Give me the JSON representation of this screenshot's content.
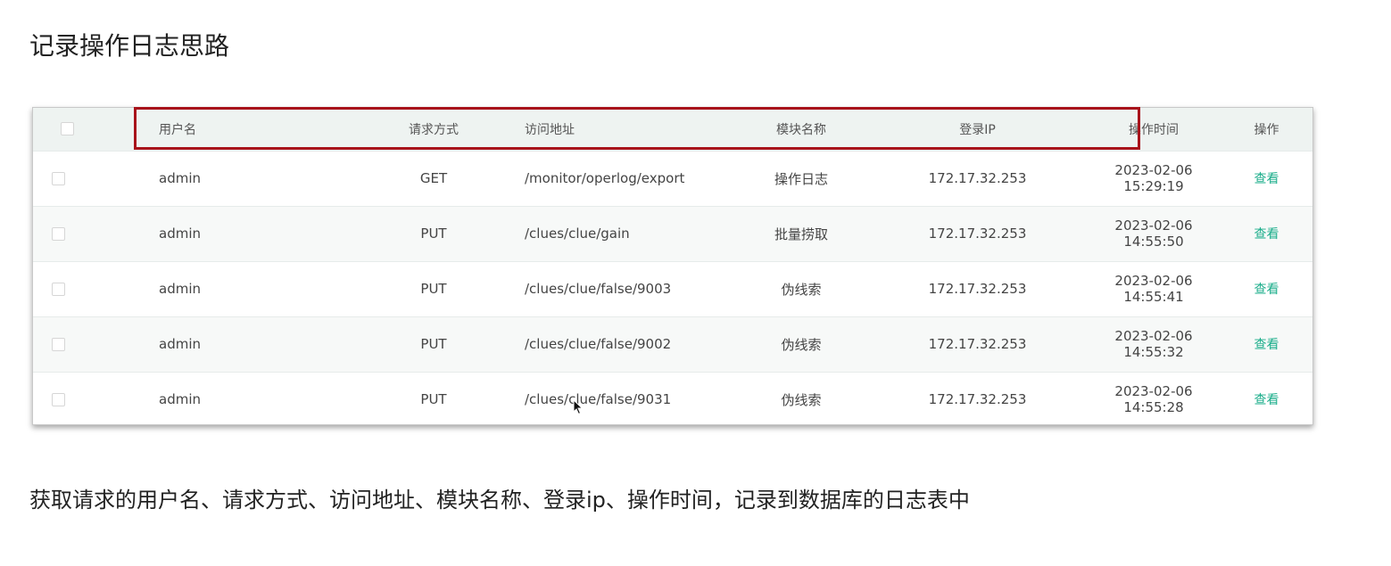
{
  "title": "记录操作日志思路",
  "table": {
    "headers": {
      "username": "用户名",
      "method": "请求方式",
      "url": "访问地址",
      "module": "模块名称",
      "ip": "登录IP",
      "time": "操作时间",
      "action": "操作"
    },
    "rows": [
      {
        "username": "admin",
        "method": "GET",
        "url": "/monitor/operlog/export",
        "module": "操作日志",
        "ip": "172.17.32.253",
        "time": "2023-02-06 15:29:19",
        "action": "查看"
      },
      {
        "username": "admin",
        "method": "PUT",
        "url": "/clues/clue/gain",
        "module": "批量捞取",
        "ip": "172.17.32.253",
        "time": "2023-02-06 14:55:50",
        "action": "查看"
      },
      {
        "username": "admin",
        "method": "PUT",
        "url": "/clues/clue/false/9003",
        "module": "伪线索",
        "ip": "172.17.32.253",
        "time": "2023-02-06 14:55:41",
        "action": "查看"
      },
      {
        "username": "admin",
        "method": "PUT",
        "url": "/clues/clue/false/9002",
        "module": "伪线索",
        "ip": "172.17.32.253",
        "time": "2023-02-06 14:55:32",
        "action": "查看"
      },
      {
        "username": "admin",
        "method": "PUT",
        "url": "/clues/clue/false/9031",
        "module": "伪线索",
        "ip": "172.17.32.253",
        "time": "2023-02-06 14:55:28",
        "action": "查看"
      }
    ]
  },
  "caption": "获取请求的用户名、请求方式、访问地址、模块名称、登录ip、操作时间，记录到数据库的日志表中",
  "colors": {
    "accent": "#1aad8a",
    "highlight": "#a8131b",
    "header_bg": "#eef3f1"
  }
}
